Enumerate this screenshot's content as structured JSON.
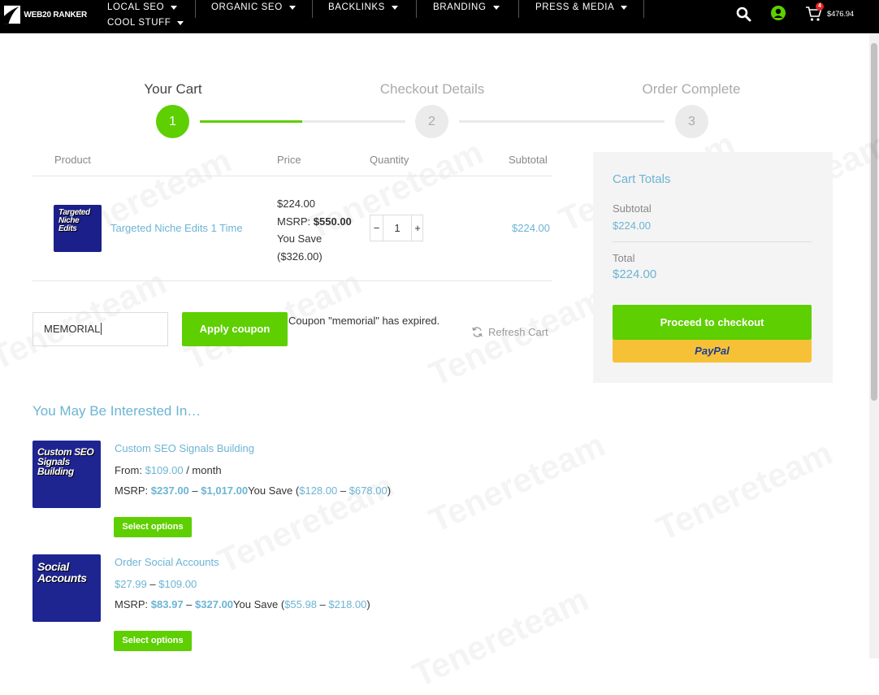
{
  "brand": {
    "logo_text": "WEB20 RANKER"
  },
  "nav": {
    "items": [
      {
        "label": "LOCAL SEO"
      },
      {
        "label": "ORGANIC SEO"
      },
      {
        "label": "BACKLINKS"
      },
      {
        "label": "BRANDING"
      },
      {
        "label": "PRESS & MEDIA"
      },
      {
        "label": "COOL STUFF"
      }
    ],
    "cart_count": "4",
    "cart_amount": "$476.94"
  },
  "steps": [
    {
      "number": "1",
      "label": "Your Cart"
    },
    {
      "number": "2",
      "label": "Checkout Details"
    },
    {
      "number": "3",
      "label": "Order Complete"
    }
  ],
  "cart_table": {
    "headers": {
      "product": "Product",
      "price": "Price",
      "quantity": "Quantity",
      "subtotal": "Subtotal"
    },
    "row": {
      "thumb_text": "Targeted Niche Edits",
      "name": "Targeted Niche Edits 1 Time",
      "price": "$224.00",
      "msrp_label": "MSRP:",
      "msrp_value": "$550.00",
      "you_save_label": "You Save",
      "you_save_value": "($326.00)",
      "quantity": "1",
      "subtotal": "$224.00"
    }
  },
  "coupon": {
    "value": "MEMORIAL",
    "apply_label": "Apply coupon",
    "message": "Coupon \"memorial\" has expired.",
    "refresh_label": "Refresh Cart"
  },
  "totals": {
    "title": "Cart Totals",
    "subtotal_label": "Subtotal",
    "subtotal_value": "$224.00",
    "total_label": "Total",
    "total_value": "$224.00",
    "checkout_label": "Proceed to checkout",
    "paypal_label": "PayPal"
  },
  "recommended": {
    "title": "You May Be Interested In…",
    "items": [
      {
        "thumb_text": "Custom SEO Signals Building",
        "name": "Custom SEO Signals Building",
        "from_label": "From:",
        "from_value": "$109.00",
        "period": "/ month",
        "msrp_label": "MSRP:",
        "msrp_low": "$237.00",
        "msrp_high": "$1,017.00",
        "save_label": "You Save (",
        "save_low": "$128.00",
        "save_high": "$678.00",
        "select_label": "Select options"
      },
      {
        "thumb_text": "Social Accounts",
        "name": "Order Social Accounts",
        "price_low": "$27.99",
        "price_high": "$109.00",
        "msrp_label": "MSRP:",
        "msrp_low": "$83.97",
        "msrp_high": "$327.00",
        "save_label": "You Save (",
        "save_low": "$55.98",
        "save_high": "$218.00",
        "select_label": "Select options"
      }
    ]
  },
  "watermark": "Tenereteam",
  "colors": {
    "green": "#5ecf00",
    "link": "#6cb4d4",
    "paypal": "#f7c137",
    "paypal_text": "#1b3f95"
  }
}
